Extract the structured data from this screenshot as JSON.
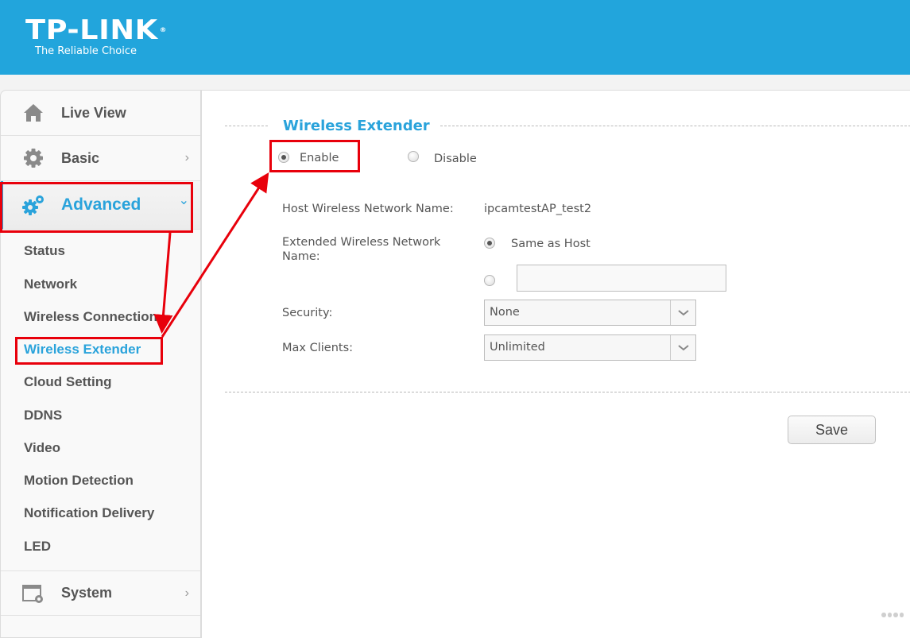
{
  "header": {
    "brand": "TP-LINK",
    "registered_mark": "®",
    "tagline": "The Reliable Choice",
    "background_color": "#22a5dc"
  },
  "sidebar": {
    "main_items": [
      {
        "label": "Live View",
        "icon": "home-icon",
        "arrow": ""
      },
      {
        "label": "Basic",
        "icon": "gear-icon",
        "arrow": "›"
      },
      {
        "label": "Advanced",
        "icon": "gears-icon",
        "arrow": "⌄",
        "active": true
      },
      {
        "label": "System",
        "icon": "system-window-gear-icon",
        "arrow": "›"
      }
    ],
    "advanced_sub_items": [
      {
        "label": "Status"
      },
      {
        "label": "Network"
      },
      {
        "label": "Wireless Connection"
      },
      {
        "label": "Wireless Extender",
        "active": true
      },
      {
        "label": "Cloud Setting"
      },
      {
        "label": "DDNS"
      },
      {
        "label": "Video"
      },
      {
        "label": "Motion Detection"
      },
      {
        "label": "Notification Delivery"
      },
      {
        "label": "LED"
      }
    ],
    "accent_color": "#2aa3db"
  },
  "main": {
    "section_title": "Wireless Extender",
    "mode": {
      "options": [
        "Enable",
        "Disable"
      ],
      "selected": "Enable"
    },
    "host_network": {
      "label": "Host Wireless Network Name:",
      "value": "ipcamtestAP_test2"
    },
    "extended_network": {
      "label_line1": "Extended Wireless Network",
      "label_line2": "Name:",
      "option_same": "Same as Host",
      "selected": "Same as Host",
      "custom_value": ""
    },
    "security": {
      "label": "Security:",
      "value": "None"
    },
    "max_clients": {
      "label": "Max Clients:",
      "value": "Unlimited"
    },
    "save_label": "Save"
  },
  "annotations": {
    "highlight_color": "#e8000b"
  }
}
